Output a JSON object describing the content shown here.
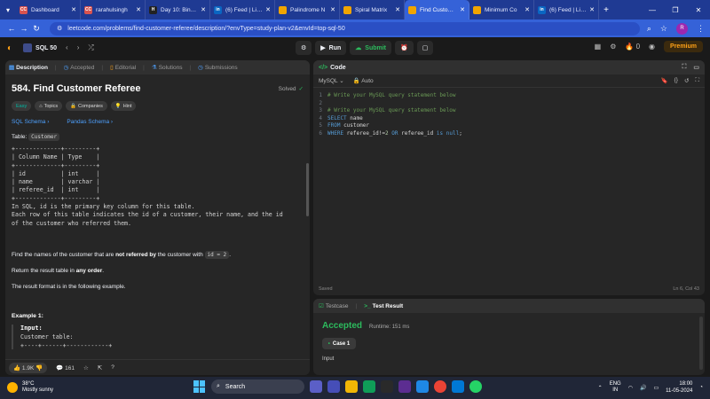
{
  "browser": {
    "tabs": [
      {
        "label": "Dashboard",
        "fav_color": "#d9534f",
        "fav_text": "CC"
      },
      {
        "label": "rarahulsingh",
        "fav_color": "#d9534f",
        "fav_text": "CC"
      },
      {
        "label": "Day 10: Binary",
        "fav_color": "#222222",
        "fav_text": "H"
      },
      {
        "label": "(6) Feed | LinkedIn",
        "fav_color": "#0a66c2",
        "fav_text": "in"
      },
      {
        "label": "Palindrome N",
        "fav_color": "#f0a500",
        "fav_text": ""
      },
      {
        "label": "Spiral Matrix",
        "fav_color": "#f0a500",
        "fav_text": ""
      },
      {
        "label": "Find Customer",
        "fav_color": "#f0a500",
        "fav_text": "",
        "active": true
      },
      {
        "label": "Minimum Co",
        "fav_color": "#f0a500",
        "fav_text": ""
      },
      {
        "label": "(6) Feed | LinkedIn",
        "fav_color": "#0a66c2",
        "fav_text": "in"
      }
    ],
    "url": "leetcode.com/problems/find-customer-referee/description/?envType=study-plan-v2&envId=top-sql-50",
    "profile_initial": "R"
  },
  "lc_nav": {
    "list_name": "SQL 50",
    "run_label": "Run",
    "submit_label": "Submit",
    "streak": "0",
    "premium_label": "Premium"
  },
  "left_tabs": [
    "Description",
    "Accepted",
    "Editorial",
    "Solutions",
    "Submissions"
  ],
  "problem": {
    "title": "584. Find Customer Referee",
    "solved_label": "Solved",
    "tags": [
      "Easy",
      "Topics",
      "Companies",
      "Hint"
    ],
    "schema_links": [
      "SQL Schema",
      "Pandas Schema"
    ],
    "table_label": "Table:",
    "table_name": "Customer",
    "schema_pre": "+-------------+---------+\n| Column Name | Type    |\n+-------------+---------+\n| id          | int     |\n| name        | varchar |\n| referee_id  | int     |\n+-------------+---------+\nIn SQL, id is the primary key column for this table.\nEach row of this table indicates the id of a customer, their name, and the id\nof the customer who referred them.",
    "task_prefix": "Find the names of the customer that are ",
    "task_bold": "not referred by",
    "task_suffix": " the customer with ",
    "task_code": "id = 2",
    "task_end": ".",
    "return_prefix": "Return the result table in ",
    "return_bold": "any order",
    "return_end": ".",
    "format_text": "The result format is in the following example.",
    "example_heading": "Example 1:",
    "example_input_label": "Input:",
    "example_table_label": "Customer table:",
    "example_border": "+----+------+------------+"
  },
  "left_footer": {
    "likes": "1.9K",
    "comments": "161"
  },
  "code_panel": {
    "title": "Code",
    "language": "MySQL",
    "auto_label": "Auto",
    "saved_label": "Saved",
    "cursor_pos": "Ln 6, Col 43",
    "lines": [
      {
        "n": "1",
        "text": "# Write your MySQL query statement below"
      },
      {
        "n": "2",
        "text": ""
      },
      {
        "n": "3",
        "text": "# Write your MySQL query statement below"
      },
      {
        "n": "4",
        "text": "SELECT name"
      },
      {
        "n": "5",
        "text": "FROM customer"
      },
      {
        "n": "6",
        "text": "WHERE referee_id!=2 OR referee_id is null;"
      }
    ]
  },
  "test_panel": {
    "testcase_label": "Testcase",
    "result_label": "Test Result",
    "status": "Accepted",
    "runtime": "Runtime: 151 ms",
    "case_label": "Case 1",
    "input_label": "Input"
  },
  "taskbar": {
    "temp": "38°C",
    "weather": "Mostly sunny",
    "search_label": "Search",
    "lang_top": "ENG",
    "lang_bottom": "IN",
    "time": "18:00",
    "date": "11-05-2024"
  }
}
